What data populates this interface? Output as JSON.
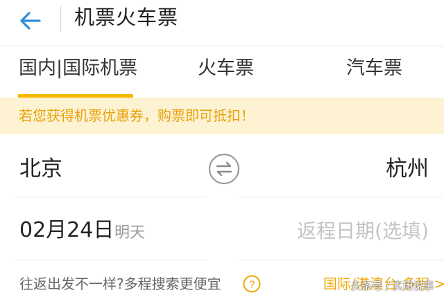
{
  "header": {
    "back_icon": "arrow-left-icon",
    "title": "机票火车票"
  },
  "tabs": [
    {
      "label": "国内|国际机票",
      "active": true
    },
    {
      "label": "火车票",
      "active": false
    },
    {
      "label": "汽车票",
      "active": false
    }
  ],
  "notice": {
    "text": "若您获得机票优惠券，购票即可抵扣！"
  },
  "route": {
    "from_city": "北京",
    "to_city": "杭州",
    "swap_icon": "swap-arrows-icon"
  },
  "dates": {
    "depart_date": "02月24日",
    "depart_day": "明天",
    "return_placeholder": "返程日期(选填)"
  },
  "footer": {
    "multi_trip_text": "往返出发不一样?多程搜索更便宜",
    "help_icon": "question-circle-icon",
    "intl_link": "国际/港澳台·多程 >",
    "watermark": "头条号 / 实用说事"
  },
  "colors": {
    "accent": "#f5b800",
    "notice_bg": "#fdf3d2",
    "notice_text": "#e8a10c",
    "back_arrow": "#2f8cd8",
    "placeholder": "#c4c4c4"
  }
}
